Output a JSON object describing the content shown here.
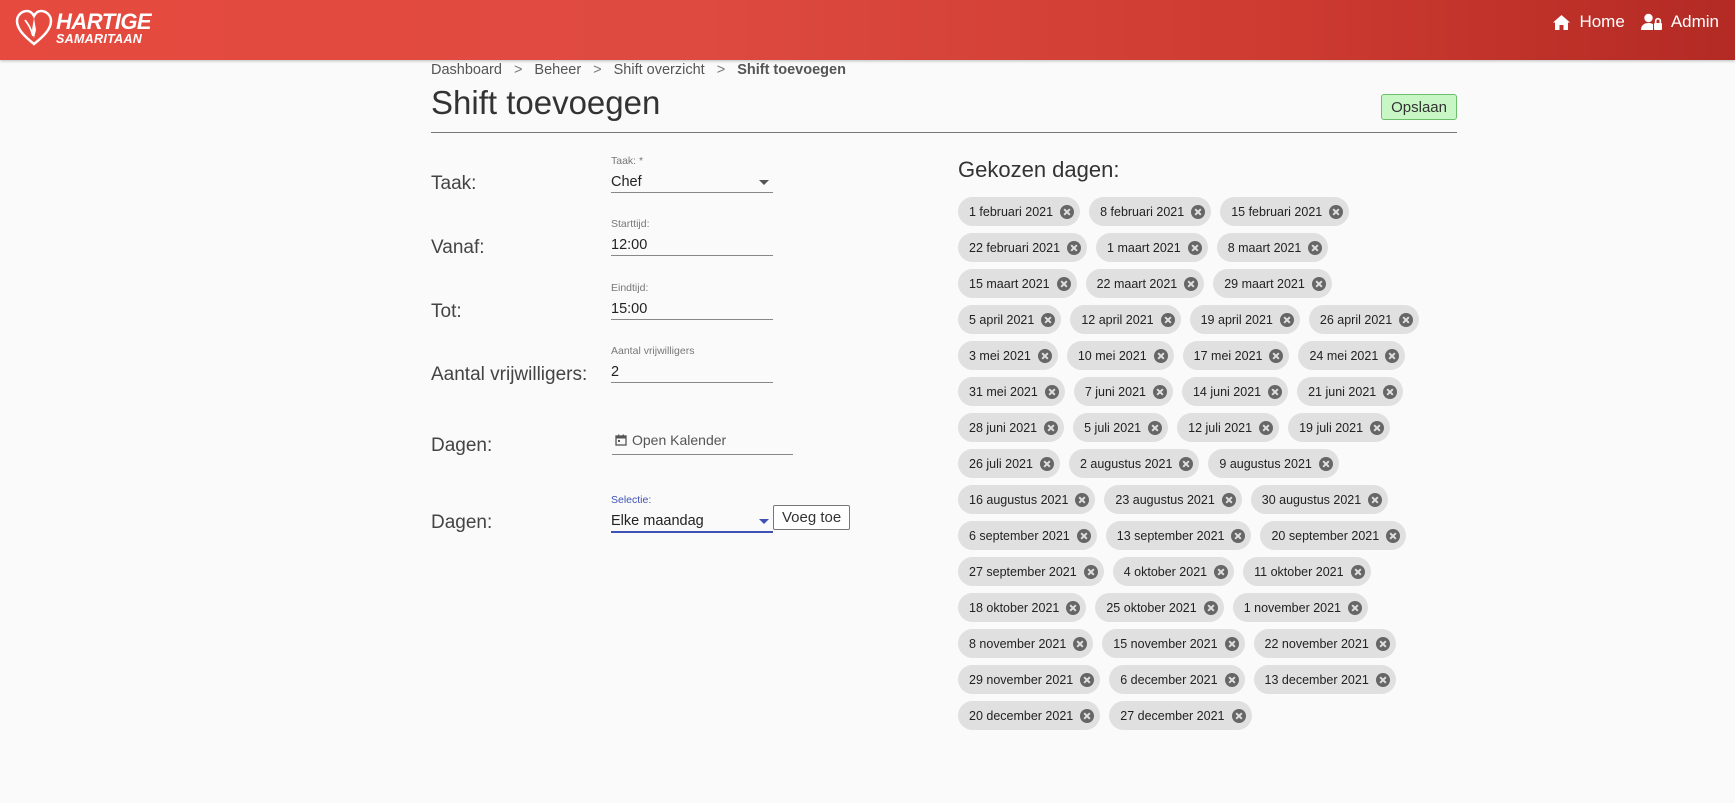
{
  "app": {
    "logo": {
      "line1": "HARTIGE",
      "line2": "SAMARITAAN"
    },
    "nav": {
      "home": "Home",
      "admin": "Admin"
    }
  },
  "breadcrumb": [
    "Dashboard",
    "Beheer",
    "Shift overzicht",
    "Shift toevoegen"
  ],
  "breadcrumb_separator": ">",
  "page": {
    "title": "Shift toevoegen",
    "save_label": "Opslaan"
  },
  "form": {
    "taak": {
      "label": "Taak:",
      "field_label": "Taak: *",
      "value": "Chef"
    },
    "vanaf": {
      "label": "Vanaf:",
      "field_label": "Starttijd:",
      "value": "12:00"
    },
    "tot": {
      "label": "Tot:",
      "field_label": "Eindtijd:",
      "value": "15:00"
    },
    "aantal": {
      "label": "Aantal vrijwilligers:",
      "field_label": "Aantal vrijwilligers",
      "value": "2"
    },
    "dagen_kalender": {
      "label": "Dagen:",
      "button": "Open Kalender"
    },
    "dagen_selectie": {
      "label": "Dagen:",
      "field_label": "Selectie:",
      "value": "Elke maandag",
      "add_label": "Voeg toe"
    }
  },
  "chosen": {
    "title": "Gekozen dagen:",
    "rows": [
      [
        "1 februari 2021",
        "8 februari 2021",
        "15 februari 2021"
      ],
      [
        "22 februari 2021",
        "1 maart 2021",
        "8 maart 2021"
      ],
      [
        "15 maart 2021",
        "22 maart 2021",
        "29 maart 2021"
      ],
      [
        "5 april 2021",
        "12 april 2021",
        "19 april 2021",
        "26 april 2021"
      ],
      [
        "3 mei 2021",
        "10 mei 2021",
        "17 mei 2021",
        "24 mei 2021"
      ],
      [
        "31 mei 2021",
        "7 juni 2021",
        "14 juni 2021",
        "21 juni 2021"
      ],
      [
        "28 juni 2021",
        "5 juli 2021",
        "12 juli 2021",
        "19 juli 2021"
      ],
      [
        "26 juli 2021",
        "2 augustus 2021",
        "9 augustus 2021"
      ],
      [
        "16 augustus 2021",
        "23 augustus 2021",
        "30 augustus 2021"
      ],
      [
        "6 september 2021",
        "13 september 2021",
        "20 september 2021"
      ],
      [
        "27 september 2021",
        "4 oktober 2021",
        "11 oktober 2021"
      ],
      [
        "18 oktober 2021",
        "25 oktober 2021",
        "1 november 2021"
      ],
      [
        "8 november 2021",
        "15 november 2021",
        "22 november 2021"
      ],
      [
        "29 november 2021",
        "6 december 2021",
        "13 december 2021"
      ],
      [
        "20 december 2021",
        "27 december 2021"
      ]
    ]
  }
}
